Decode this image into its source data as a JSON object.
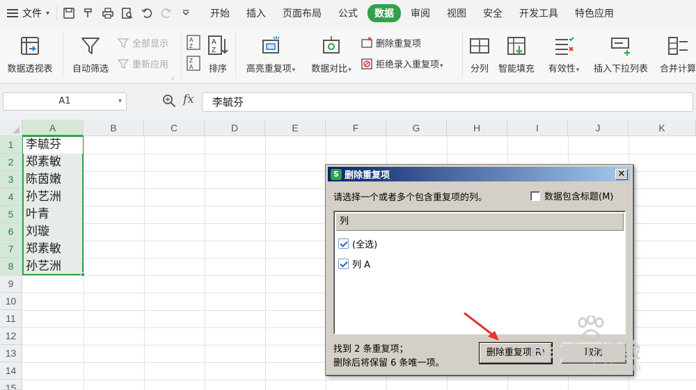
{
  "menubar": {
    "file_label": "文件",
    "tabs": [
      "开始",
      "插入",
      "页面布局",
      "公式",
      "数据",
      "审阅",
      "视图",
      "安全",
      "开发工具",
      "特色应用"
    ],
    "active_tab": "数据"
  },
  "ribbon": {
    "pivot": "数据透视表",
    "autofilter": "自动筛选",
    "show_all": "全部显示",
    "reapply": "重新应用",
    "sort": "排序",
    "highlight_dup": "高亮重复项",
    "compare": "数据对比",
    "remove_dup": "删除重复项",
    "reject_dup": "拒绝录入重复项",
    "split": "分列",
    "smart_fill": "智能填充",
    "validity": "有效性",
    "insert_dropdown": "插入下拉列表",
    "merge_calc": "合并计算"
  },
  "formula_bar": {
    "name_box": "A1",
    "fx": "fx",
    "value": "李毓芬"
  },
  "sheet": {
    "columns": [
      "A",
      "B",
      "C",
      "D",
      "E",
      "F",
      "G",
      "H",
      "I",
      "J",
      "K"
    ],
    "rows": [
      "1",
      "2",
      "3",
      "4",
      "5",
      "6",
      "7",
      "8",
      "9",
      "10",
      "11",
      "12",
      "13",
      "14",
      "15"
    ],
    "col_a": [
      "李毓芬",
      "郑素敏",
      "陈茵嫩",
      "孙艺洲",
      "叶青",
      "刘璇",
      "郑素敏",
      "孙艺洲"
    ]
  },
  "dialog": {
    "title": "删除重复项",
    "logo_letter": "S",
    "close": "✕",
    "prompt": "请选择一个或者多个包含重复项的列。",
    "header_checkbox": "数据包含标题(M)",
    "list_header": "列",
    "items": [
      "(全选)",
      "列 A"
    ],
    "info_line1": "找到 2 条重复项；",
    "info_line2": "删除后将保留 6 条唯一项。",
    "btn_remove": "删除重复项(R)",
    "btn_cancel": "取消"
  },
  "watermark": {
    "brand": "Baidu 经验",
    "url": "jingyan.baidu.com"
  },
  "colors": {
    "accent": "#31a14a",
    "dialog_title_start": "#0a246a",
    "dialog_title_end": "#a6caf0",
    "arrow": "#e8322d"
  }
}
